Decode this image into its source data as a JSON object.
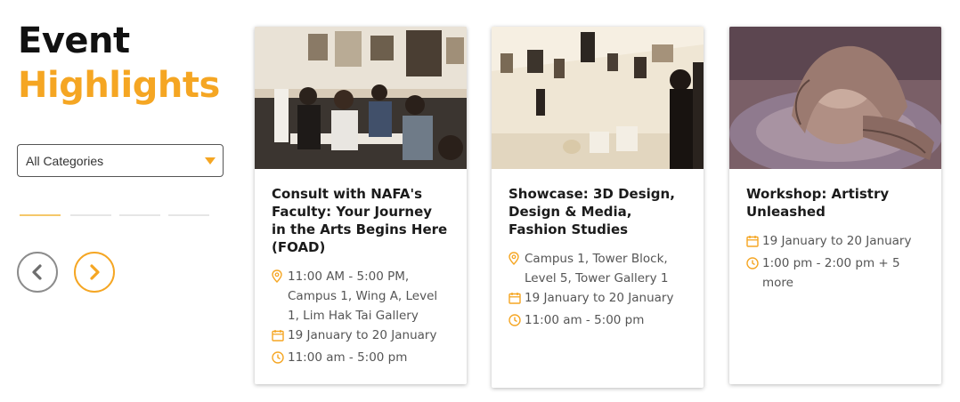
{
  "heading": {
    "line1": "Event",
    "line2": "Highlights"
  },
  "filter": {
    "selected": "All Categories"
  },
  "colors": {
    "accent": "#f5a623",
    "title": "#1b1b1b",
    "muted": "#555555"
  },
  "cards": [
    {
      "title": "Consult with NAFA's Faculty: Your Journey in the Arts Begins Here (FOAD)",
      "location": "11:00 AM - 5:00 PM, Campus 1, Wing A, Level 1, Lim Hak Tai Gallery",
      "date": "19 January to 20 January",
      "time": "11:00 am - 5:00 pm"
    },
    {
      "title": "Showcase: 3D Design, Design & Media, Fashion Studies",
      "location": "Campus 1, Tower Block, Level 5, Tower Gallery 1",
      "date": "19 January to 20 January",
      "time": "11:00 am - 5:00 pm"
    },
    {
      "title": "Workshop: Artistry Unleashed",
      "date": "19 January to 20 January",
      "time": "1:00 pm - 2:00 pm + 5 more"
    }
  ],
  "icons": {
    "location": "map-pin-icon",
    "date": "calendar-icon",
    "time": "clock-icon",
    "prev": "chevron-left-icon",
    "next": "chevron-right-icon"
  }
}
